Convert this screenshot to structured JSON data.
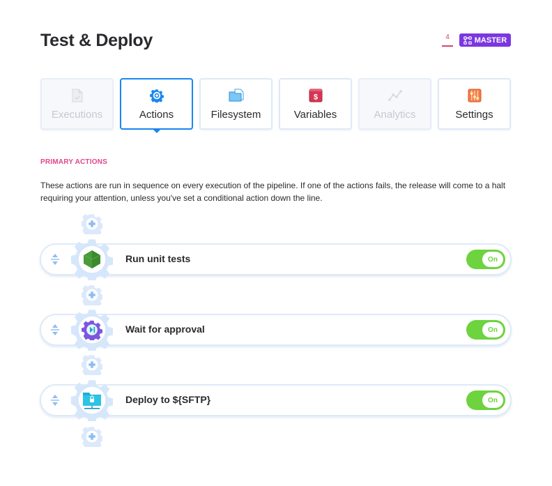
{
  "header": {
    "title": "Test & Deploy",
    "branch_count": "4",
    "branch_name": "MASTER",
    "colors": {
      "branch_badge": "#7b37e0",
      "count": "#d0466b"
    }
  },
  "tabs": [
    {
      "label": "Executions",
      "icon": "document-check-icon",
      "state": "disabled"
    },
    {
      "label": "Actions",
      "icon": "gear-icon",
      "state": "active"
    },
    {
      "label": "Filesystem",
      "icon": "folder-icon",
      "state": "normal"
    },
    {
      "label": "Variables",
      "icon": "dollar-icon",
      "state": "normal"
    },
    {
      "label": "Analytics",
      "icon": "chart-line-icon",
      "state": "disabled"
    },
    {
      "label": "Settings",
      "icon": "sliders-icon",
      "state": "normal"
    }
  ],
  "section": {
    "label": "PRIMARY ACTIONS",
    "description": "These actions are run in sequence on every execution of the pipeline. If one of the actions fails, the release will come to a halt requiring your attention, unless you've set a conditional action down the line."
  },
  "actions": [
    {
      "name": "Run unit tests",
      "icon": "nodejs-icon",
      "toggle": "On",
      "enabled": true
    },
    {
      "name": "Wait for approval",
      "icon": "approval-icon",
      "toggle": "On",
      "enabled": true
    },
    {
      "name": "Deploy to ${SFTP}",
      "icon": "sftp-folder-icon",
      "toggle": "On",
      "enabled": true
    }
  ],
  "colors": {
    "accent": "#1a87f0",
    "toggle_on": "#6dd33e",
    "section_label": "#e0468a",
    "gear": "#d4e6fb"
  }
}
